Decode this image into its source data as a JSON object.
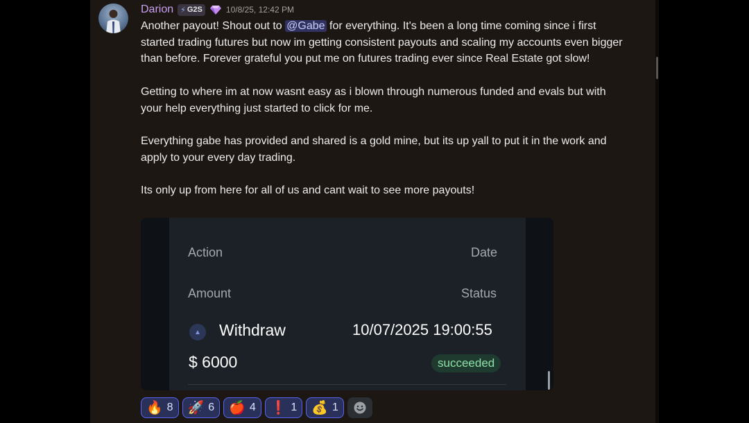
{
  "post": {
    "username": "Darion",
    "tag_icon": "lightning-bolt",
    "tag": "G2S",
    "badge_icon": "purple-gem-icon",
    "timestamp": "10/8/25, 12:42 PM",
    "para1_before": "Another payout! Shout out to ",
    "mention": "@Gabe",
    "para1_after": " for everything. It's been a long time coming since i first started trading futures but now im getting consistent payouts and scaling my accounts even bigger than before. Forever grateful you put me on futures trading ever since Real Estate got slow!",
    "para2": "Getting to where im at now wasnt easy as i blown through numerous funded and evals but with your help everything just started to click for me.",
    "para3": "Everything gabe has provided and shared is a gold mine, but its up yall to put it in the work and apply to your every day trading.",
    "para4": "Its only up from here for all of us and cant wait to see more payouts!"
  },
  "attachment": {
    "action_label": "Action",
    "date_label": "Date",
    "amount_label": "Amount",
    "status_label": "Status",
    "action_icon": "up-arrow-icon",
    "action_value": "Withdraw",
    "date_value": "10/07/2025 19:00:55",
    "amount_value": "$ 6000",
    "status_value": "succeeded"
  },
  "reactions": [
    {
      "emoji": "🔥",
      "icon": "fire-emoji",
      "count": "8"
    },
    {
      "emoji": "🚀",
      "icon": "rocket-emoji",
      "count": "6"
    },
    {
      "emoji": "🍎",
      "icon": "apple-emoji",
      "count": "4"
    },
    {
      "emoji": "❗",
      "icon": "exclamation-emoji",
      "count": "1"
    },
    {
      "emoji": "💰",
      "icon": "money-bag-emoji",
      "count": "1"
    }
  ],
  "add_reaction_icon": "smiley-icon",
  "colors": {
    "username": "#c9a0f0",
    "mention_bg": "#5865f2",
    "reaction_border": "#5865f2",
    "status_green": "#8ee0a9"
  }
}
